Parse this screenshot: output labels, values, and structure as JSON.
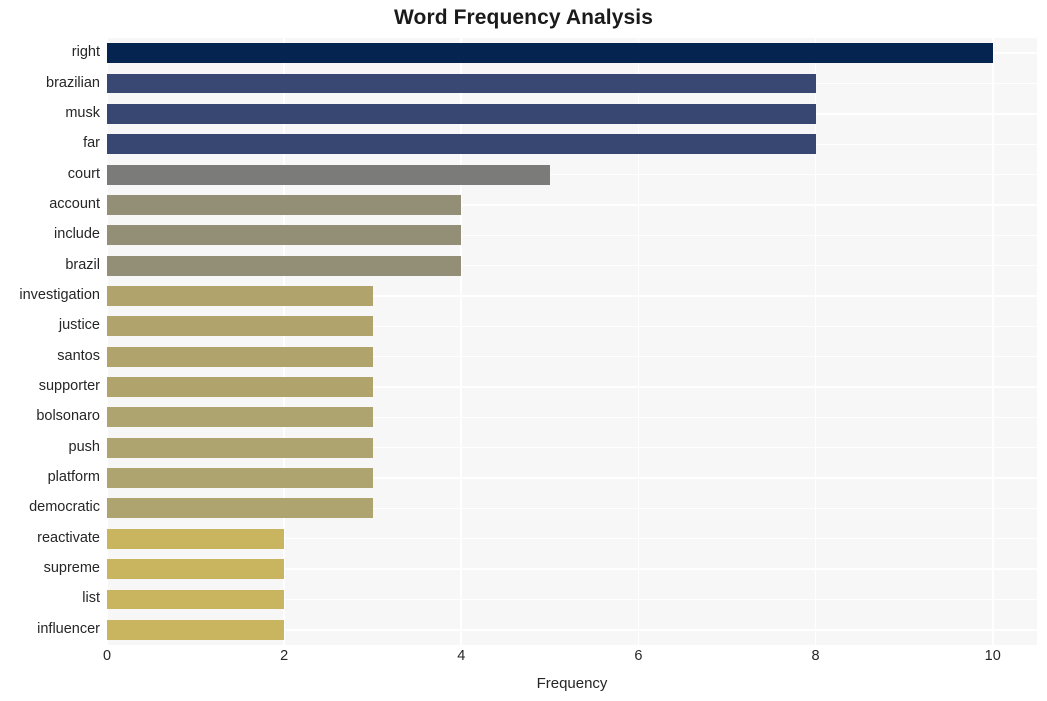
{
  "chart_data": {
    "type": "bar",
    "orientation": "horizontal",
    "title": "Word Frequency Analysis",
    "xlabel": "Frequency",
    "ylabel": "",
    "xlim": [
      0,
      10.5
    ],
    "xticks": [
      0,
      2,
      4,
      6,
      8,
      10
    ],
    "xtick_labels": [
      "0",
      "2",
      "4",
      "6",
      "8",
      "10"
    ],
    "grid": true,
    "grid_color": "#ffffff",
    "plot_background": "#f7f7f7",
    "figure_background": "#ffffff",
    "legend": "none",
    "categories": [
      "right",
      "brazilian",
      "musk",
      "far",
      "court",
      "account",
      "include",
      "brazil",
      "investigation",
      "justice",
      "santos",
      "supporter",
      "bolsonaro",
      "push",
      "platform",
      "democratic",
      "reactivate",
      "supreme",
      "list",
      "influencer"
    ],
    "values": [
      10,
      8,
      8,
      8,
      5,
      4,
      4,
      4,
      3,
      3,
      3,
      3,
      3,
      3,
      3,
      3,
      2,
      2,
      2,
      2
    ],
    "bar_colors": [
      "#062450",
      "#394872",
      "#384771",
      "#384771",
      "#7b7b79",
      "#938e76",
      "#938e76",
      "#938e76",
      "#b0a46c",
      "#b0a46c",
      "#b0a46c",
      "#b0a46c",
      "#aea46f",
      "#aea46f",
      "#aea46f",
      "#aea470",
      "#c9b560",
      "#c9b560",
      "#c9b560",
      "#c9b560"
    ]
  }
}
